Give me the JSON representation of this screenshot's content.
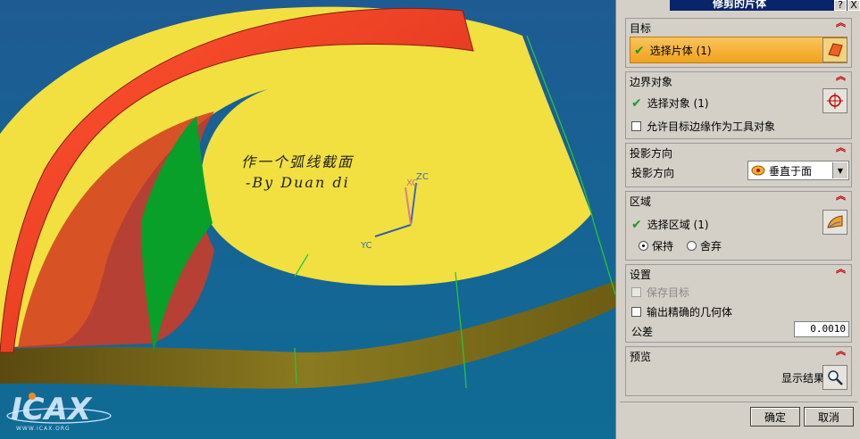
{
  "dialog": {
    "title": "修剪的片体",
    "title_buttons": [
      "?",
      "X"
    ]
  },
  "viewport": {
    "annotation_line1": "作一个弧线截面",
    "annotation_line2": "-By Duan di",
    "axes": {
      "zc": "ZC",
      "xc": "XC",
      "yc": "YC"
    },
    "watermark": "WWW.ICAX.ORG",
    "watermark_logo": "ICAX"
  },
  "sections": {
    "target": {
      "header": "目标",
      "select_label": "选择片体 (1)",
      "icon": "sheet-body-icon"
    },
    "boundary": {
      "header": "边界对象",
      "select_label": "选择对象 (1)",
      "icon": "crosshair-icon",
      "allow_edge_label": "允许目标边缘作为工具对象"
    },
    "projection": {
      "header": "投影方向",
      "label": "投影方向",
      "selected": "垂直于面",
      "icon": "normal-to-face-icon"
    },
    "region": {
      "header": "区域",
      "select_label": "选择区域 (1)",
      "icon": "region-icon",
      "keep_label": "保持",
      "discard_label": "舍弃",
      "keep_selected": true
    },
    "settings": {
      "header": "设置",
      "keep_target_label": "保存目标",
      "exact_output_label": "输出精确的几何体",
      "tolerance_label": "公差",
      "tolerance_value": "0.0010"
    },
    "preview": {
      "header": "预览",
      "show_result_label": "显示结果",
      "icon": "magnifier-icon"
    }
  },
  "buttons": {
    "ok": "确定",
    "cancel": "取消"
  },
  "colors": {
    "viewport_bg": "#10507c",
    "yellow_surface": "#f1e040",
    "red_band": "#ea3f25",
    "green_surface": "#08a028",
    "highlight": "#f2a21c"
  }
}
